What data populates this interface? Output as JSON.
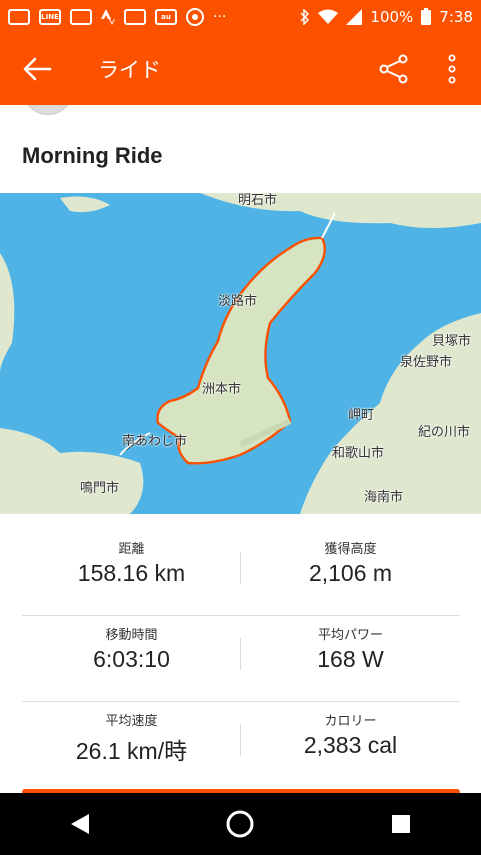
{
  "status": {
    "battery": "100%",
    "time": "7:38",
    "line": "LINE",
    "au": "au"
  },
  "app_bar": {
    "title": "ライド"
  },
  "activity": {
    "title": "Morning Ride"
  },
  "map": {
    "labels": [
      "明石市",
      "淡路市",
      "洲本市",
      "南あわじ市",
      "鳴門市",
      "貝塚市",
      "泉佐野市",
      "岬町",
      "紀の川市",
      "和歌山市",
      "海南市"
    ],
    "route_color": "#fc5200",
    "water_color": "#4fb3e6",
    "land_color": "#e8efd8"
  },
  "stats": [
    [
      {
        "label": "距離",
        "value": "158.16 km"
      },
      {
        "label": "獲得高度",
        "value": "2,106 m"
      }
    ],
    [
      {
        "label": "移動時間",
        "value": "6:03:10"
      },
      {
        "label": "平均パワー",
        "value": "168 W"
      }
    ],
    [
      {
        "label": "平均速度",
        "value": "26.1 km/時"
      },
      {
        "label": "カロリー",
        "value": "2,383 cal"
      }
    ]
  ]
}
